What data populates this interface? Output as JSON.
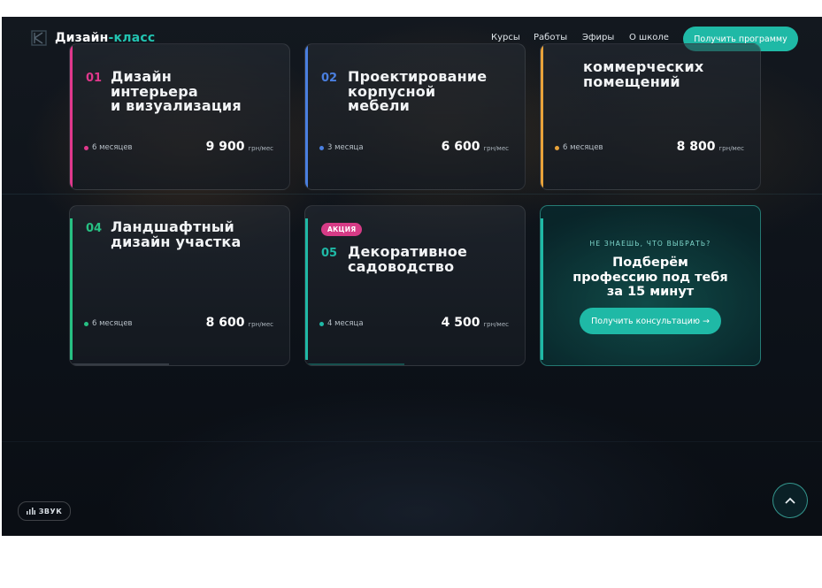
{
  "header": {
    "logo_word": "Дизайн",
    "logo_accent": "-класс",
    "nav": [
      "Курсы",
      "Работы",
      "Эфиры",
      "О школе"
    ],
    "cta_label": "Получить программу"
  },
  "cards": [
    {
      "num": "01",
      "title_lines": [
        "Дизайн",
        "интерьера",
        "и визуализация"
      ],
      "duration": "6 месяцев",
      "price": "9 900",
      "unit": "грн/мес",
      "accent": "#e0388c"
    },
    {
      "num": "02",
      "title_lines": [
        "Проектирование",
        "корпусной",
        "мебели"
      ],
      "duration": "3 месяца",
      "price": "6 600",
      "unit": "грн/мес",
      "accent": "#4a7fe0"
    },
    {
      "num": "",
      "title_lines": [
        "коммерческих",
        "помещений"
      ],
      "duration": "6 месяцев",
      "price": "8 800",
      "unit": "грн/мес",
      "accent": "#e8a23a"
    },
    {
      "num": "04",
      "title_lines": [
        "Ландшафтный",
        "дизайн участка"
      ],
      "duration": "6 месяцев",
      "price": "8 600",
      "unit": "грн/мес",
      "accent": "#27c083"
    },
    {
      "num": "05",
      "badge": "АКЦИЯ",
      "title_lines": [
        "Декоративное",
        "садоводство"
      ],
      "duration": "4 месяца",
      "price": "4 500",
      "unit": "грн/мес",
      "accent": "#1fb9a6"
    }
  ],
  "consult": {
    "kicker": "НЕ ЗНАЕШЬ, ЧТО ВЫБРАТЬ?",
    "head_lines": [
      "Подберём",
      "профессию под тебя",
      "за 15 минут"
    ],
    "button_label": "Получить консультацию →"
  },
  "sound_label": "ЗВУК",
  "colors": {
    "accent": "#1fb9a6",
    "badge": "#d63b86",
    "background": "#0d1219"
  },
  "icons": {
    "logo": "logo-mark-icon",
    "sound": "sound-bars-icon",
    "to_top": "chevron-up-icon"
  }
}
